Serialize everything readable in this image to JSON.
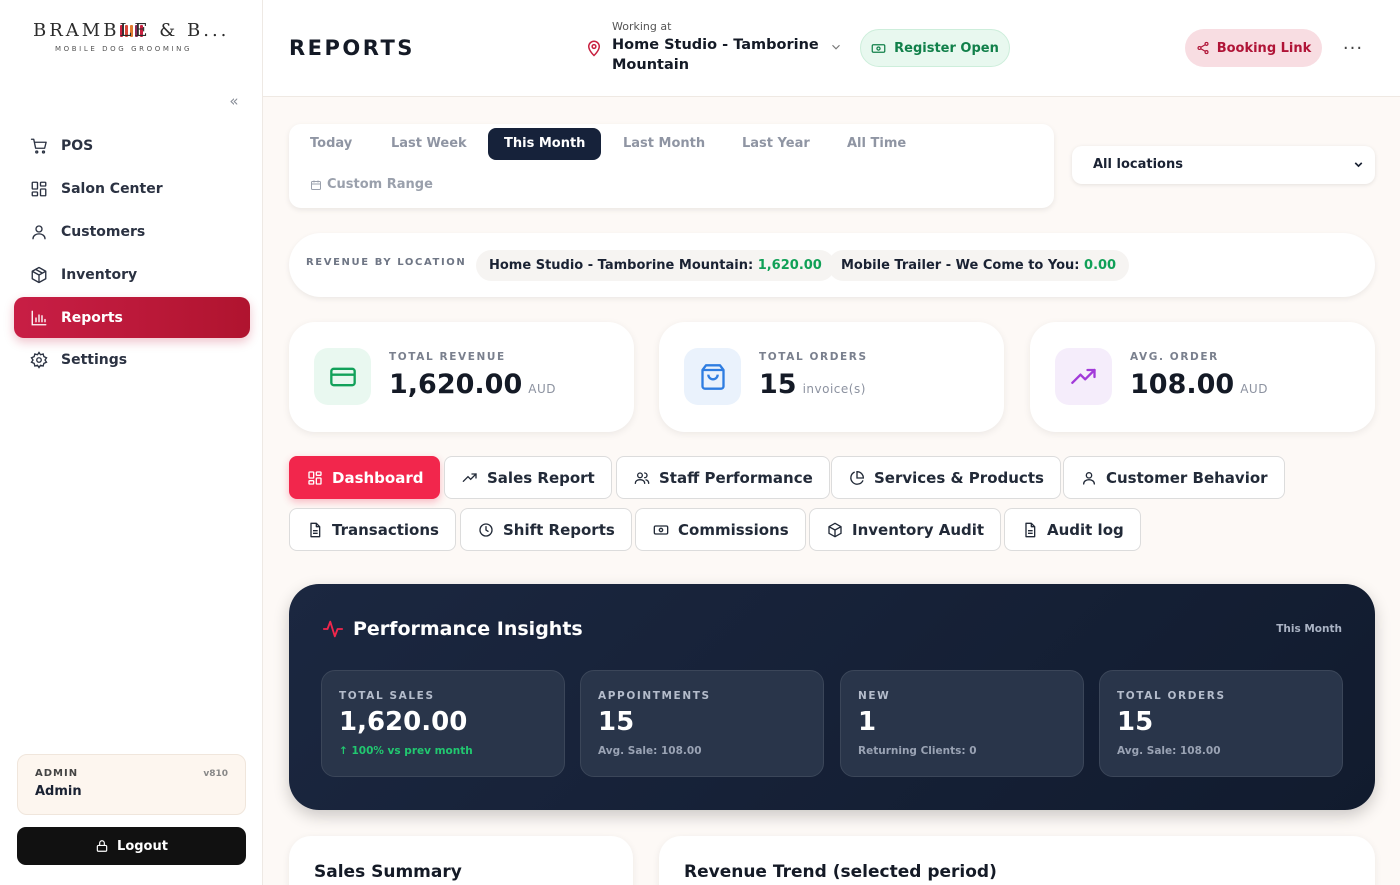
{
  "brand": {
    "name": "BRAMBLE & B...",
    "tagline": "MOBILE DOG GROOMING",
    "bar_colors": [
      "#c8203f",
      "#d9473a",
      "#e07a2e",
      "#8a2a5a",
      "#c8203f"
    ]
  },
  "sidebar": {
    "items": [
      {
        "label": "POS",
        "icon": "cart-icon"
      },
      {
        "label": "Salon Center",
        "icon": "grid-icon"
      },
      {
        "label": "Customers",
        "icon": "user-icon"
      },
      {
        "label": "Inventory",
        "icon": "box-icon"
      },
      {
        "label": "Reports",
        "icon": "bar-chart-icon",
        "active": true
      },
      {
        "label": "Settings",
        "icon": "gear-icon"
      }
    ],
    "user": {
      "role": "ADMIN",
      "version": "v810",
      "name": "Admin"
    },
    "logout_label": "Logout"
  },
  "header": {
    "title": "REPORTS",
    "location_caption": "Working at",
    "location_name": "Home Studio - Tamborine Mountain",
    "register_label": "Register Open",
    "booking_label": "Booking Link",
    "more_label": "..."
  },
  "filters": {
    "ranges": [
      "Today",
      "Last Week",
      "This Month",
      "Last Month",
      "Last Year",
      "All Time"
    ],
    "active_range": "This Month",
    "custom_range": "Custom Range",
    "location_select": "All locations"
  },
  "revenue_by_location": {
    "label": "REVENUE BY LOCATION",
    "items": [
      {
        "name": "Home Studio - Tamborine Mountain:",
        "value": "1,620.00"
      },
      {
        "name": "Mobile Trailer - We Come to You:",
        "value": "0.00"
      }
    ]
  },
  "stats": [
    {
      "label": "TOTAL REVENUE",
      "value": "1,620.00",
      "unit": "AUD",
      "icon": "credit-card-icon",
      "color": "#12a15a",
      "bg": "#e9f8f0"
    },
    {
      "label": "TOTAL ORDERS",
      "value": "15",
      "unit": "invoice(s)",
      "icon": "shopping-bag-icon",
      "color": "#2f7de1",
      "bg": "#eaf2fc"
    },
    {
      "label": "AVG. ORDER",
      "value": "108.00",
      "unit": "AUD",
      "icon": "trending-up-icon",
      "color": "#a23ad9",
      "bg": "#f5edfb"
    }
  ],
  "report_tabs": [
    {
      "label": "Dashboard",
      "icon": "dashboard-icon",
      "active": true
    },
    {
      "label": "Sales Report",
      "icon": "trending-up-icon"
    },
    {
      "label": "Staff Performance",
      "icon": "users-icon"
    },
    {
      "label": "Services & Products",
      "icon": "pie-chart-icon"
    },
    {
      "label": "Customer Behavior",
      "icon": "user-icon"
    },
    {
      "label": "Transactions",
      "icon": "file-icon"
    },
    {
      "label": "Shift Reports",
      "icon": "clock-icon"
    },
    {
      "label": "Commissions",
      "icon": "banknote-icon"
    },
    {
      "label": "Inventory Audit",
      "icon": "box-icon"
    },
    {
      "label": "Audit log",
      "icon": "file-icon"
    }
  ],
  "performance": {
    "title": "Performance Insights",
    "period": "This Month",
    "boxes": [
      {
        "label": "TOTAL SALES",
        "value": "1,620.00",
        "sub": "↑ 100% vs prev month"
      },
      {
        "label": "APPOINTMENTS",
        "value": "15",
        "sub": "Avg. Sale: 108.00"
      },
      {
        "label": "NEW",
        "value": "1",
        "sub": "Returning Clients: 0"
      },
      {
        "label": "TOTAL ORDERS",
        "value": "15",
        "sub": "Avg. Sale: 108.00"
      }
    ]
  },
  "bottom": {
    "sales_summary": "Sales Summary",
    "revenue_trend": "Revenue Trend (selected period)"
  }
}
